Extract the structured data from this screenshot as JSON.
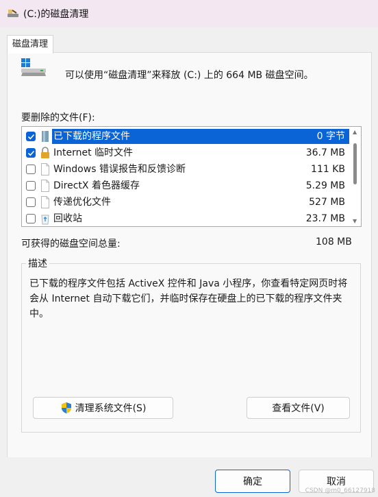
{
  "window": {
    "title": "(C:)的磁盘清理"
  },
  "tabs": [
    {
      "label": "磁盘清理"
    }
  ],
  "summary": "可以使用“磁盘清理”来释放 (C:) 上的 664 MB 磁盘空间。",
  "files_label": "要删除的文件(F):",
  "files": [
    {
      "name": "已下载的程序文件",
      "size": "0 字节",
      "checked": true,
      "selected": true,
      "icon": "folder-icon"
    },
    {
      "name": "Internet 临时文件",
      "size": "36.7 MB",
      "checked": true,
      "selected": false,
      "icon": "lock-icon"
    },
    {
      "name": "Windows 错误报告和反馈诊断",
      "size": "111 KB",
      "checked": false,
      "selected": false,
      "icon": "document-icon"
    },
    {
      "name": "DirectX 着色器缓存",
      "size": "5.29 MB",
      "checked": false,
      "selected": false,
      "icon": "document-icon"
    },
    {
      "name": "传递优化文件",
      "size": "527 MB",
      "checked": false,
      "selected": false,
      "icon": "document-icon"
    },
    {
      "name": "回收站",
      "size": "23.7 MB",
      "checked": false,
      "selected": false,
      "icon": "recycle-bin-icon"
    }
  ],
  "total": {
    "label": "可获得的磁盘空间总量:",
    "value": "108 MB"
  },
  "description": {
    "title": "描述",
    "text": "已下载的程序文件包括 ActiveX 控件和 Java 小程序，你查看特定网页时将会从 Internet 自动下载它们，并临时保存在硬盘上的已下载的程序文件夹中。"
  },
  "buttons": {
    "clean_system": "清理系统文件(S)",
    "view_files": "查看文件(V)",
    "ok": "确定",
    "cancel": "取消"
  },
  "watermark": "CSDN @m0_66127918",
  "colors": {
    "accent": "#0a64d6",
    "titlebar": "#f3e8f1"
  }
}
